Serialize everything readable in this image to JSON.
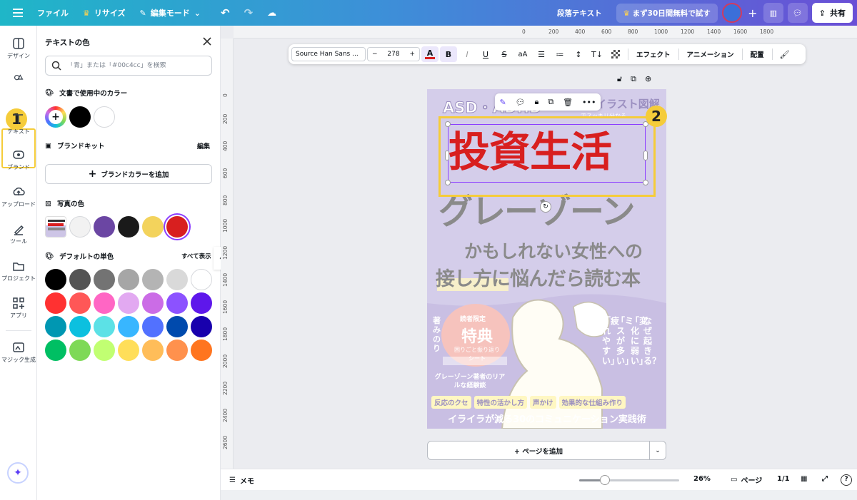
{
  "topbar": {
    "file": "ファイル",
    "resize": "リサイズ",
    "edit_mode": "編集モード",
    "doc_title": "段落テキスト",
    "trial": "まず30日間無料で試す",
    "share": "共有"
  },
  "nav": {
    "design": "デザイン",
    "text": "テキスト",
    "brand": "ブランド",
    "upload": "アップロード",
    "tools": "ツール",
    "projects": "プロジェクト",
    "apps": "アプリ",
    "magic": "マジック生成",
    "badge1": "1"
  },
  "panel": {
    "title": "テキストの色",
    "search_placeholder": "「青」または「#00c4cc」を検索",
    "doc_colors_title": "文書で使用中のカラー",
    "doc_colors": [
      "#000000",
      "#ffffff"
    ],
    "brandkit_title": "ブランドキット",
    "brandkit_edit": "編集",
    "add_brand_color": "ブランドカラーを追加",
    "photo_colors_title": "写真の色",
    "photo_colors": [
      "#f2f2f2",
      "#6b46a3",
      "#1a1a1a",
      "#f3d35c",
      "#d81f1f"
    ],
    "default_title": "デフォルトの単色",
    "show_all": "すべて表示",
    "default_colors": [
      [
        "#000000",
        "#545454",
        "#737373",
        "#a6a6a6",
        "#b4b4b4",
        "#d9d9d9",
        "#ffffff"
      ],
      [
        "#ff3131",
        "#ff5757",
        "#ff66c4",
        "#e2a9f1",
        "#cb6ce6",
        "#8c52ff",
        "#5e17eb"
      ],
      [
        "#0097b2",
        "#0cc0df",
        "#5ce1e6",
        "#38b6ff",
        "#5271ff",
        "#004aad",
        "#1800ad"
      ],
      [
        "#00bf63",
        "#7ed957",
        "#c1ff72",
        "#ffde59",
        "#ffbd59",
        "#ff914d",
        "#ff751f"
      ]
    ]
  },
  "toolbar": {
    "font": "Source Han Sans ...",
    "size": "278",
    "effects": "エフェクト",
    "animation": "アニメーション",
    "position": "配置"
  },
  "ruler": {
    "top": [
      "0",
      "200",
      "400",
      "600",
      "800",
      "1000",
      "1200",
      "1400",
      "1600",
      "1800"
    ],
    "left": [
      "0",
      "200",
      "400",
      "600",
      "800",
      "1000",
      "1200",
      "1400",
      "1600",
      "1800",
      "2000",
      "2200",
      "2400",
      "2600"
    ]
  },
  "cover": {
    "top_left": "ASD・ADHD",
    "top_right": "イラスト図解",
    "top_sub": "でスッキリ分かる",
    "title_red": "投資生活",
    "title_big": "グレーゾーン",
    "line1": "かもしれない女性への",
    "line2": "接し方に悩んだら読む本",
    "tokuten_small": "読者限定",
    "tokuten_big": "特典",
    "tokuten_sub": "困りごと振り返りシート",
    "author": "著 みのり",
    "vert1": "なぜ起きる？",
    "vert2": "「変化に弱い」",
    "vert3": "「ミスが多い」",
    "vert4": "「疲れやすい」",
    "gz_note": "グレーゾーン著者のリアルな経験談",
    "tags": [
      "反応のクセ",
      "特性の活かし方",
      "声かけ",
      "効果的な仕組み作り"
    ],
    "bottom": "イライラが減る30のコミュニケーション実践術",
    "badge2": "2"
  },
  "footer": {
    "add_page": "+ ページを追加",
    "memo": "メモ",
    "zoom": "26%",
    "zoom_level": 0.26,
    "pages_label": "ページ",
    "page_count": "1/1"
  }
}
